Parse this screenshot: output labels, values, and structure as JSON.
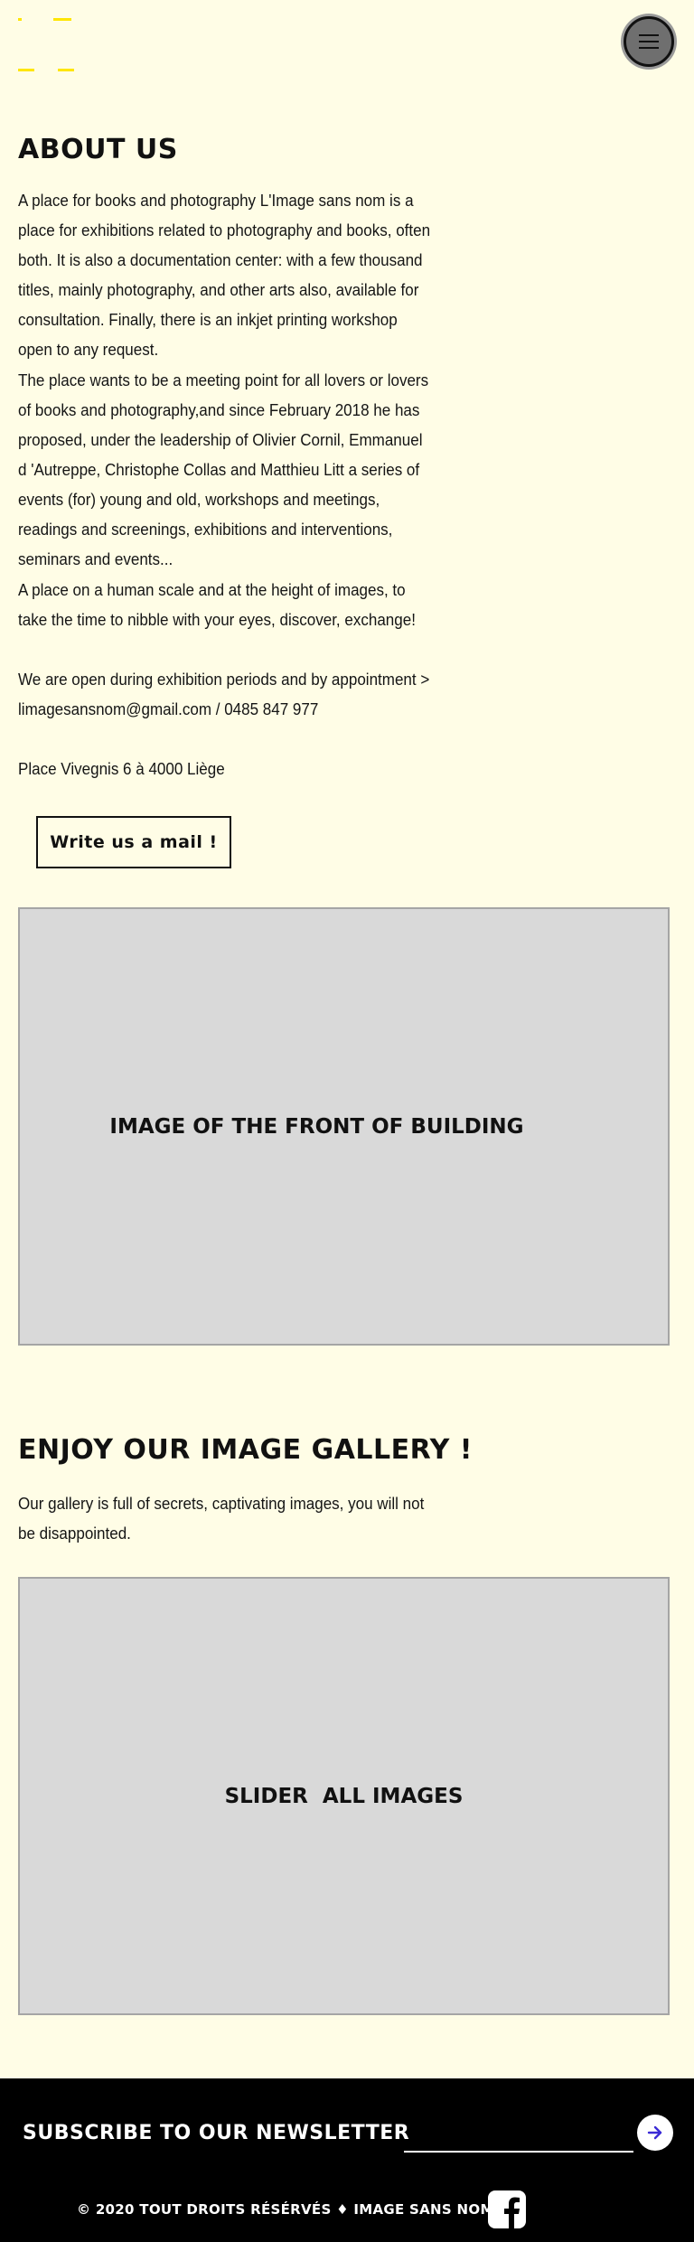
{
  "about": {
    "title": "ABOUT US",
    "paragraphs": [
      " A place for books and photography L'Image sans nom is a place for exhibitions related to photography and books, often both. It is also a documentation center: with a few thousand titles, mainly photography, and other arts also, available for consultation. Finally, there is an inkjet printing workshop open to any request.",
      "The place wants to be a meeting point for all lovers or lovers of books and photography,and since February 2018 he has proposed, under the leadership of Olivier Cornil, Emmanuel d 'Autreppe, Christophe Collas and Matthieu Litt a series of events (for) young and old, workshops and meetings, readings and screenings, exhibitions and interventions, seminars and events...",
      "A place on a human scale and at the height of images, to take the time to nibble with your eyes, discover, exchange!",
      "We are open during exhibition periods and by appointment > limagesansnom@gmail.com / 0485 847 977",
      "Place Vivegnis 6 à 4000 Liège"
    ],
    "mail_button": "Write us a mail !",
    "building_placeholder": "IMAGE OF THE FRONT OF BUILDING"
  },
  "gallery": {
    "title": "ENJOY OUR IMAGE GALLERY !",
    "text": "Our gallery is full of secrets, captivating images, you will not be disappointed.",
    "slider_placeholder": "SLIDER  ALL IMAGES"
  },
  "footer": {
    "newsletter_label": "SUBSCRIBE TO OUR NEWSLETTER",
    "email_placeholder": "",
    "copyright": "© 2020 TOUT DROITS RÉSÉRVÉS ♦ IMAGE SANS NOM"
  },
  "icons": {
    "menu": "hamburger-icon",
    "submit": "arrow-right-icon",
    "social": "facebook-icon"
  },
  "colors": {
    "background": "#fffde6",
    "logo": "#ffe600",
    "footer": "#000000",
    "placeholder": "#d9d9d9",
    "arrow": "#3b2bd6"
  }
}
